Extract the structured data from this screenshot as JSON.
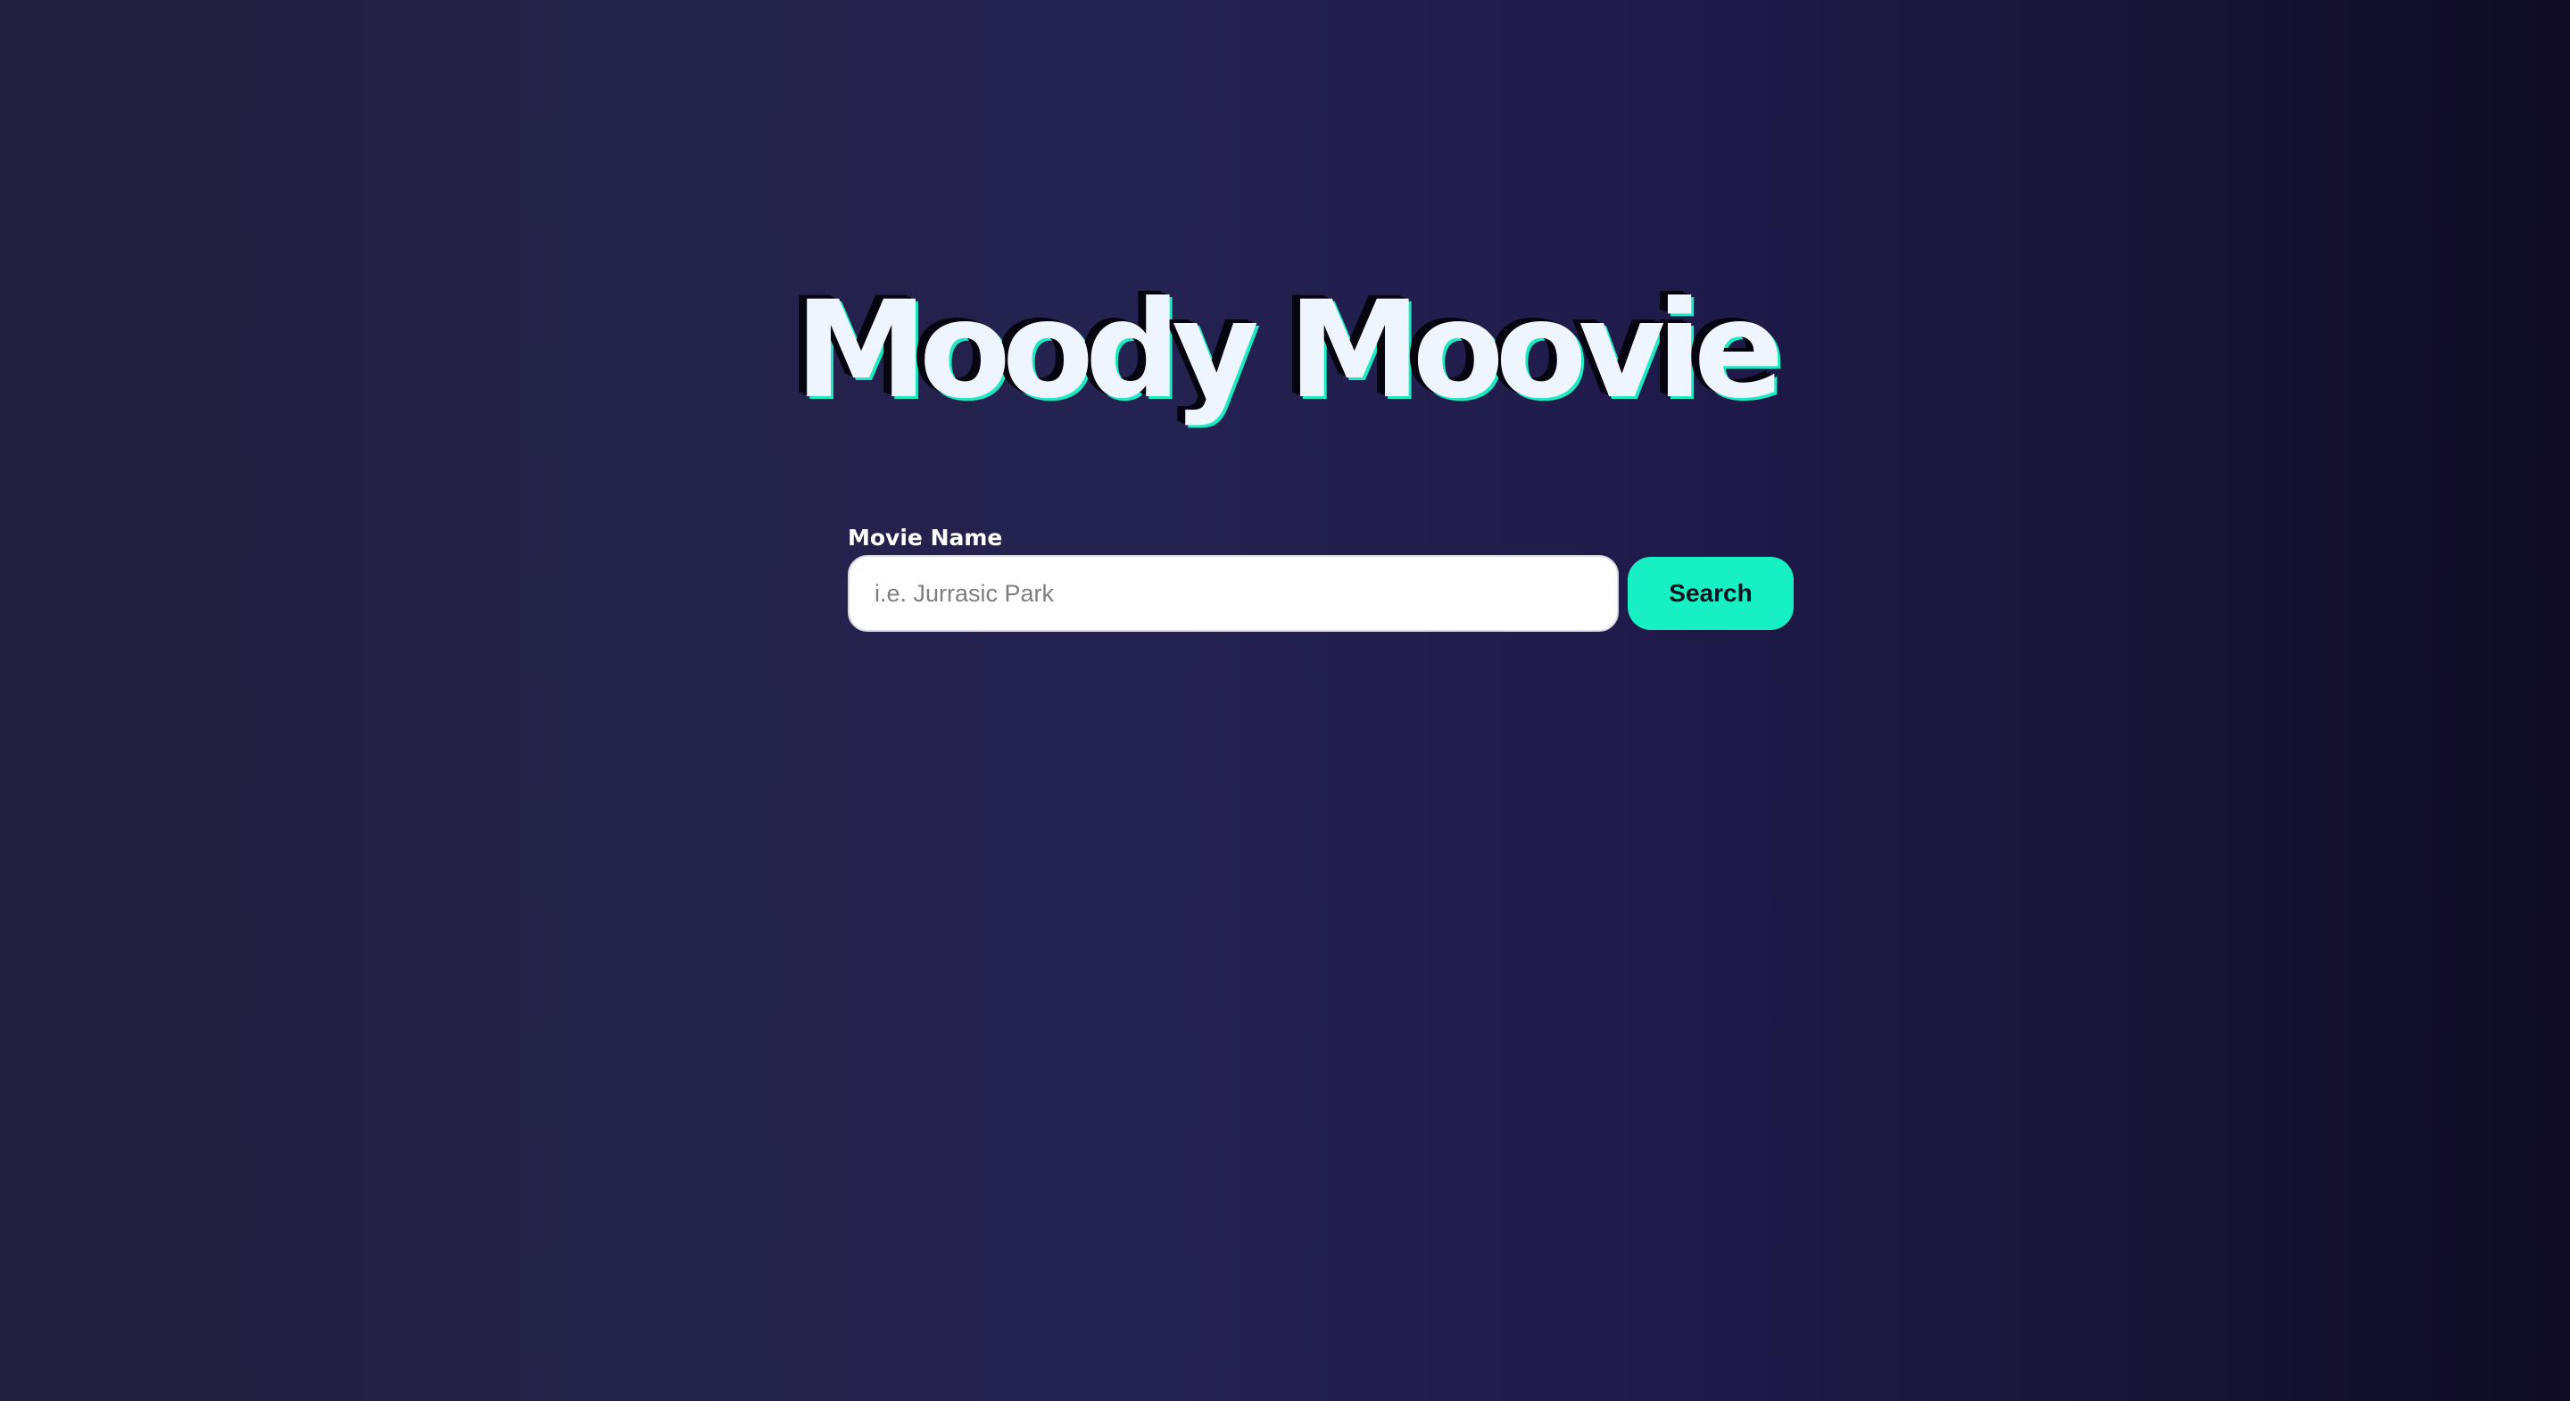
{
  "app": {
    "title": "Moody Moovie"
  },
  "search": {
    "label": "Movie Name",
    "value": "",
    "placeholder": "i.e. Jurrasic Park",
    "button_label": "Search"
  },
  "colors": {
    "accent": "#17f0c2",
    "title_text": "#eef5fc",
    "background_left": "#22213f",
    "background_right": "#0f0c24"
  }
}
